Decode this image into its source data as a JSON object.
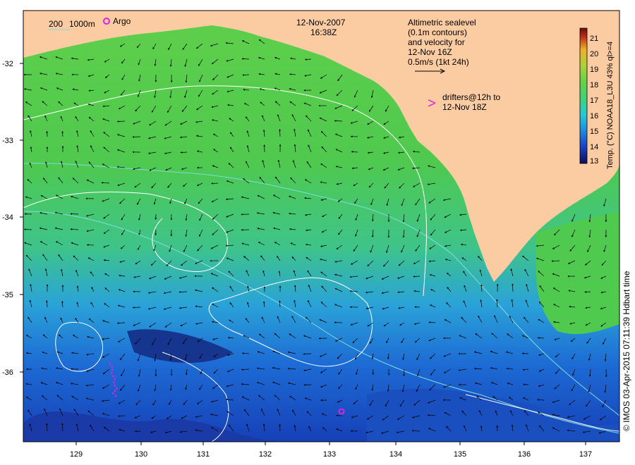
{
  "title": {
    "date": "12-Nov-2007",
    "time": "16:38Z"
  },
  "scale_legend": {
    "isobath_200": "200",
    "isobath_1000": "1000m",
    "argo": "Argo"
  },
  "sealevel_note": {
    "line1": "Altimetric sealevel",
    "line2": "(0.1m contours)",
    "line3": "and velocity for",
    "line4": "12-Nov 16Z",
    "line5": "0.5m/s (1kt 24h)"
  },
  "drifter_note": {
    "arrow": ">",
    "line1": "drifters@12h to",
    "line2": "12-Nov 18Z"
  },
  "colorbar": {
    "label": "Temp. (°C) NOAA18_L3U 43% ql>=4",
    "ticks": [
      "21",
      "20",
      "19",
      "18",
      "17",
      "16",
      "15",
      "14",
      "13"
    ],
    "min": 13,
    "max": 21.5,
    "colors": [
      "#08105e",
      "#1a3fc4",
      "#1f8fe0",
      "#27c8d8",
      "#3fd27a",
      "#62d24a",
      "#a9d23a",
      "#f0b028",
      "#b8281a",
      "#6b0f0a"
    ]
  },
  "axes": {
    "x_ticks": [
      "129",
      "130",
      "131",
      "132",
      "133",
      "134",
      "135",
      "136",
      "137"
    ],
    "y_ticks": [
      "-32",
      "-33",
      "-34",
      "-35",
      "-36"
    ],
    "x_range": [
      128.2,
      137.45
    ],
    "y_range": [
      -36.9,
      -31.1
    ]
  },
  "credit": "© IMOS 03-Apr-2015 07:11:39 Hdbart time",
  "colors": {
    "land": "#fbcca2",
    "isobath": "#7fdcdc",
    "contour": "#ffffff",
    "drifter": "#e020e0"
  }
}
